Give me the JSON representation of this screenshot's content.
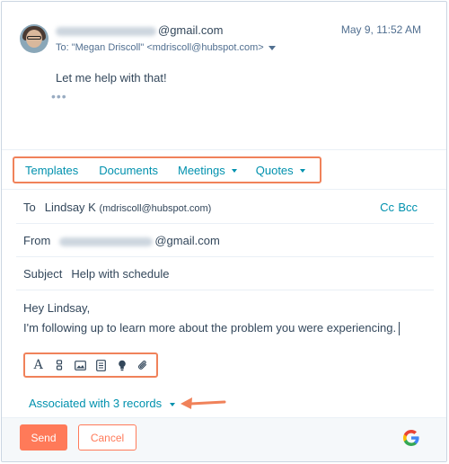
{
  "thread": {
    "sender_suffix": "@gmail.com",
    "date": "May 9, 11:52 AM",
    "to_line": "To: \"Megan Driscoll\" <mdriscoll@hubspot.com>",
    "message": "Let me help with that!",
    "ellipsis": "•••"
  },
  "tools": {
    "tabs": [
      "Templates",
      "Documents",
      "Meetings",
      "Quotes"
    ]
  },
  "compose": {
    "to_label": "To",
    "to_name": "Lindsay K",
    "to_email": "(mdriscoll@hubspot.com)",
    "cc_label": "Cc",
    "bcc_label": "Bcc",
    "from_label": "From",
    "from_suffix": "@gmail.com",
    "subject_label": "Subject",
    "subject_value": "Help with schedule",
    "body_line1": "Hey Lindsay,",
    "body_line2": "I'm following up to learn more about the problem you were experiencing."
  },
  "format_toolbar": {
    "icons": [
      "text-format-icon",
      "personalize-icon",
      "image-icon",
      "document-icon",
      "snippet-icon",
      "attachment-icon"
    ],
    "text_glyph": "A"
  },
  "associations": {
    "label": "Associated with 3 records"
  },
  "footer": {
    "send_label": "Send",
    "cancel_label": "Cancel"
  },
  "colors": {
    "accent_link": "#0091ae",
    "primary_button": "#ff7a59",
    "highlight_border": "#f0825a",
    "text": "#33475b"
  }
}
